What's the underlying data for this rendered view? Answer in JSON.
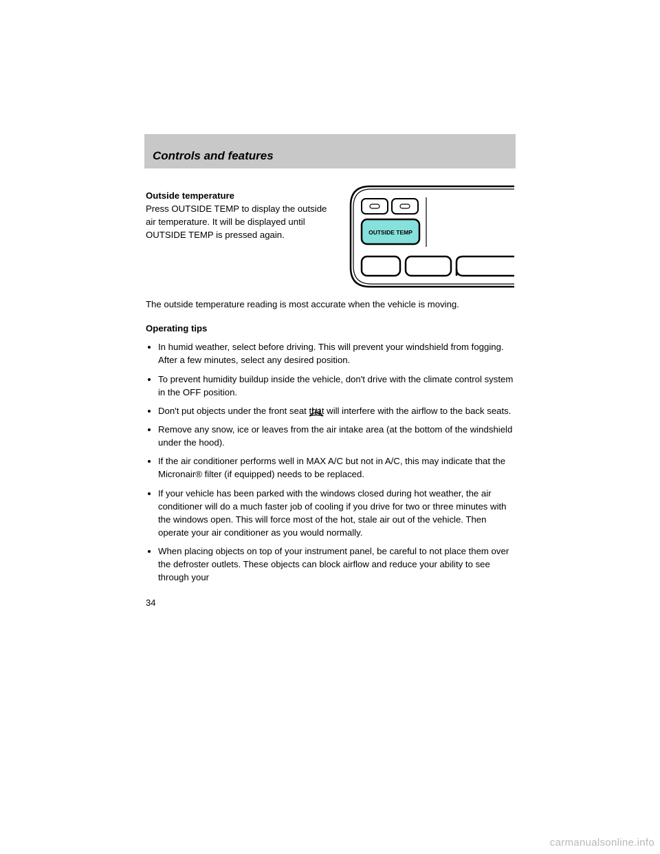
{
  "header": {
    "title": "Controls and features"
  },
  "top_block": {
    "intro": "Outside temperature",
    "body": "Press OUTSIDE TEMP to display the outside air temperature. It will be displayed until OUTSIDE TEMP is pressed again.",
    "note": "The outside temperature reading is most accurate when the vehicle is moving."
  },
  "illustration": {
    "button_label": "OUTSIDE TEMP"
  },
  "tips_heading": "Operating tips",
  "tips": [
    "In humid weather, select              before driving. This will prevent your windshield from fogging. After a few minutes, select any desired position.",
    "To prevent humidity buildup inside the vehicle, don't drive with the climate control system in the OFF position.",
    "Don't put objects under the front seat that will interfere with the airflow to the back seats.",
    "Remove any snow, ice or leaves from the air intake area (at the bottom of the windshield under the hood).",
    "If the air conditioner performs well in MAX A/C but not in A/C, this may indicate that the Micronair® filter (if equipped) needs to be replaced.",
    "If your vehicle has been parked with the windows closed during hot weather, the air conditioner will do a much faster job of cooling if you drive for two or three minutes with the windows open. This will force most of the hot, stale air out of the vehicle. Then operate your air conditioner as you would normally.",
    "When placing objects on top of your instrument panel, be careful to not place them over the defroster outlets. These objects can block airflow and reduce your ability to see through your"
  ],
  "page_number": "34",
  "watermark": "carmanualsonline.info"
}
